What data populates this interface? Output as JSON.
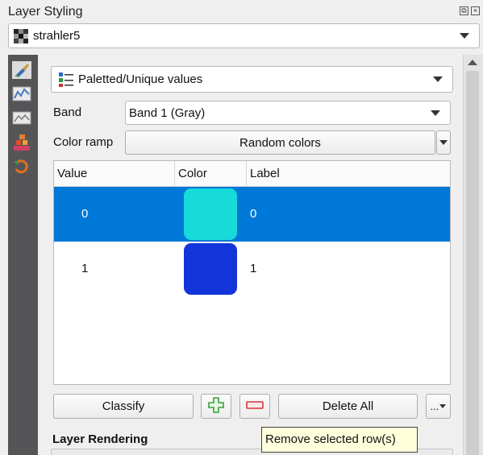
{
  "window": {
    "title": "Layer Styling"
  },
  "layer_select": {
    "value": "strahler5"
  },
  "sidebar": {
    "items": [
      {
        "icon": "paintbrush-icon"
      },
      {
        "icon": "histogram-icon"
      },
      {
        "icon": "transparency-icon"
      },
      {
        "icon": "pyramids-icon"
      },
      {
        "icon": "history-icon"
      }
    ]
  },
  "renderer": {
    "value": "Paletted/Unique values"
  },
  "band": {
    "label": "Band",
    "value": "Band 1 (Gray)"
  },
  "color_ramp": {
    "label": "Color ramp",
    "value": "Random colors"
  },
  "table": {
    "headers": [
      "Value",
      "Color",
      "Label"
    ],
    "rows": [
      {
        "value": "0",
        "color": "#17dbd8",
        "label": "0",
        "selected": true
      },
      {
        "value": "1",
        "color": "#1234d8",
        "label": "1",
        "selected": false
      }
    ]
  },
  "buttons": {
    "classify": "Classify",
    "delete_all": "Delete All",
    "more": "..."
  },
  "section": {
    "layer_rendering": "Layer Rendering"
  },
  "tooltip": {
    "text": "Remove selected row(s)"
  },
  "colors": {
    "selection": "#0078d7",
    "add_icon": "#3aa13a",
    "remove_icon": "#d8323c"
  }
}
